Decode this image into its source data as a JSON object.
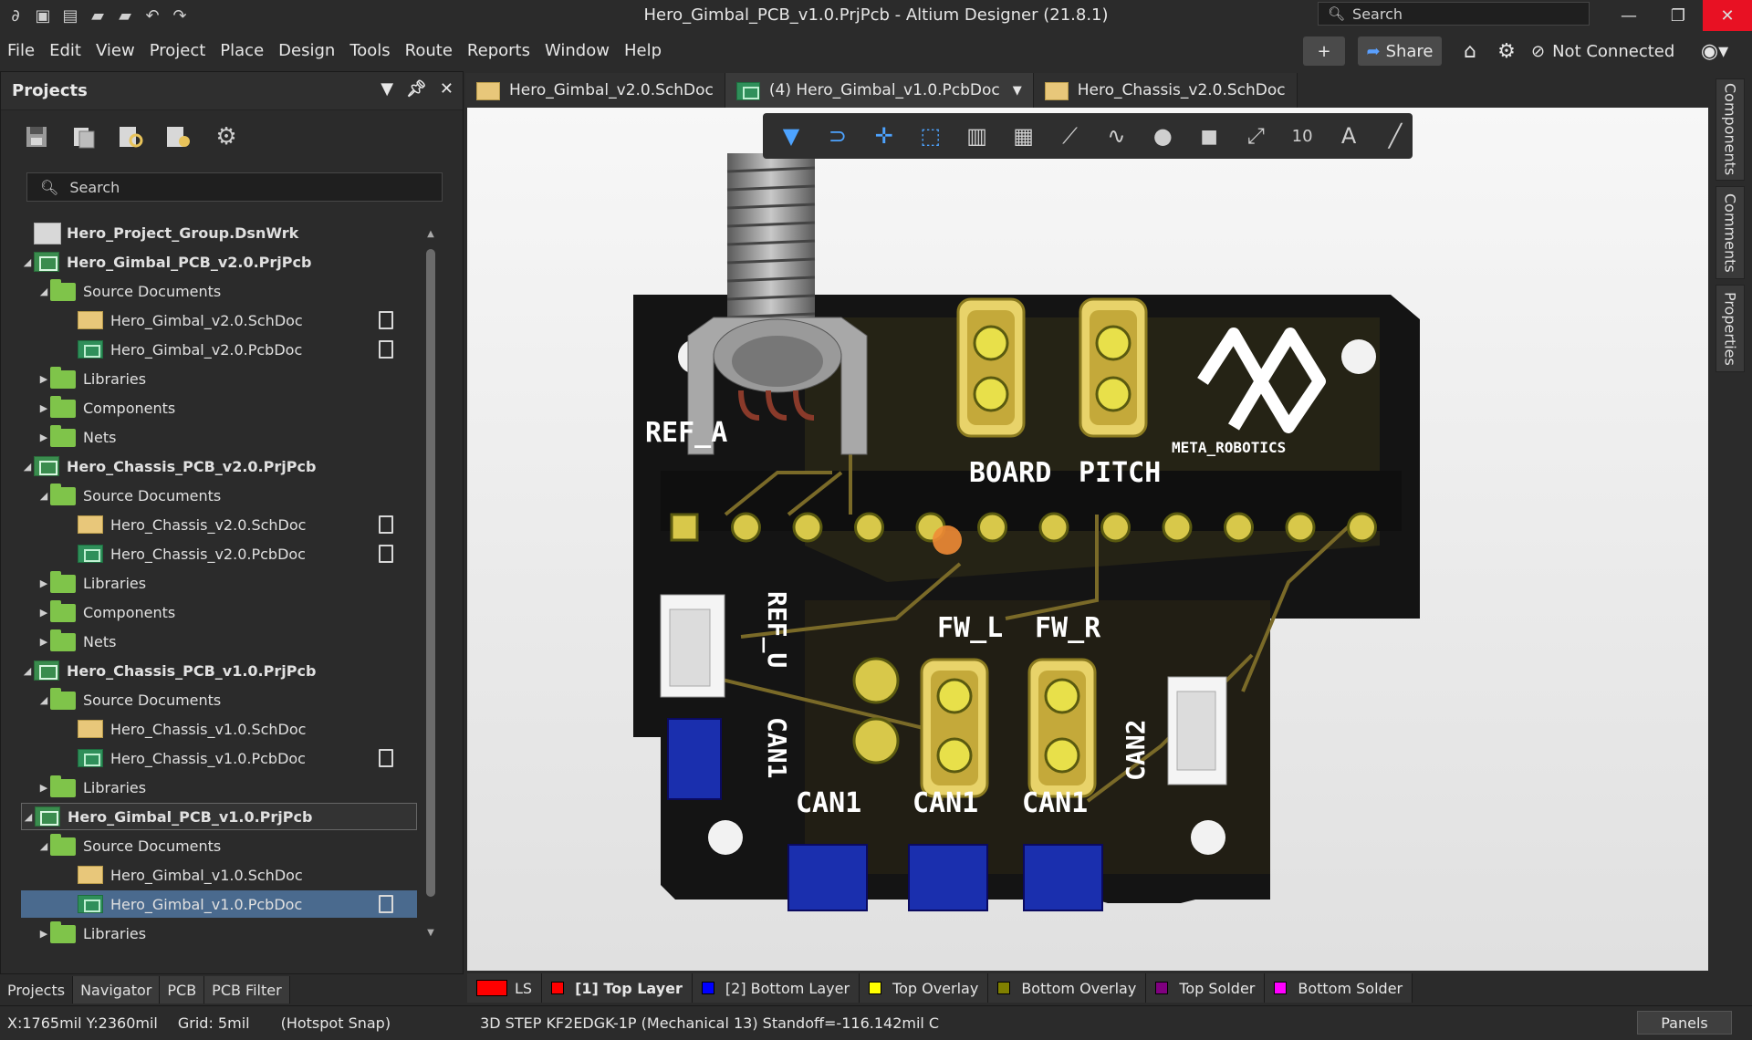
{
  "titlebar": {
    "title": "Hero_Gimbal_PCB_v1.0.PrjPcb - Altium Designer (21.8.1)",
    "search_placeholder": "Search"
  },
  "menu": [
    "File",
    "Edit",
    "View",
    "Project",
    "Place",
    "Design",
    "Tools",
    "Route",
    "Reports",
    "Window",
    "Help"
  ],
  "header_right": {
    "share_label": "Share",
    "connection_status": "Not Connected"
  },
  "projects_panel": {
    "title": "Projects",
    "search_placeholder": "Search",
    "tree": [
      {
        "label": "Hero_Project_Group.DsnWrk",
        "type": "group",
        "level": 0,
        "bold": true
      },
      {
        "label": "Hero_Gimbal_PCB_v2.0.PrjPcb",
        "type": "project",
        "level": 0,
        "bold": true
      },
      {
        "label": "Source Documents",
        "type": "folder",
        "level": 1
      },
      {
        "label": "Hero_Gimbal_v2.0.SchDoc",
        "type": "sch",
        "level": 2,
        "doc": true
      },
      {
        "label": "Hero_Gimbal_v2.0.PcbDoc",
        "type": "pcb",
        "level": 2,
        "doc": true
      },
      {
        "label": "Libraries",
        "type": "folder",
        "level": 1,
        "collapsed": true
      },
      {
        "label": "Components",
        "type": "folder",
        "level": 1,
        "collapsed": true
      },
      {
        "label": "Nets",
        "type": "folder",
        "level": 1,
        "collapsed": true
      },
      {
        "label": "Hero_Chassis_PCB_v2.0.PrjPcb",
        "type": "project",
        "level": 0,
        "bold": true
      },
      {
        "label": "Source Documents",
        "type": "folder",
        "level": 1
      },
      {
        "label": "Hero_Chassis_v2.0.SchDoc",
        "type": "sch",
        "level": 2,
        "doc": true
      },
      {
        "label": "Hero_Chassis_v2.0.PcbDoc",
        "type": "pcb",
        "level": 2,
        "doc": true
      },
      {
        "label": "Libraries",
        "type": "folder",
        "level": 1,
        "collapsed": true
      },
      {
        "label": "Components",
        "type": "folder",
        "level": 1,
        "collapsed": true
      },
      {
        "label": "Nets",
        "type": "folder",
        "level": 1,
        "collapsed": true
      },
      {
        "label": "Hero_Chassis_PCB_v1.0.PrjPcb",
        "type": "project",
        "level": 0,
        "bold": true
      },
      {
        "label": "Source Documents",
        "type": "folder",
        "level": 1
      },
      {
        "label": "Hero_Chassis_v1.0.SchDoc",
        "type": "sch",
        "level": 2
      },
      {
        "label": "Hero_Chassis_v1.0.PcbDoc",
        "type": "pcb",
        "level": 2,
        "doc": true
      },
      {
        "label": "Libraries",
        "type": "folder",
        "level": 1,
        "collapsed": true
      },
      {
        "label": "Hero_Gimbal_PCB_v1.0.PrjPcb",
        "type": "project",
        "level": 0,
        "bold": true,
        "highlight": true
      },
      {
        "label": "Source Documents",
        "type": "folder",
        "level": 1
      },
      {
        "label": "Hero_Gimbal_v1.0.SchDoc",
        "type": "sch",
        "level": 2
      },
      {
        "label": "Hero_Gimbal_v1.0.PcbDoc",
        "type": "pcb",
        "level": 2,
        "doc": true,
        "selected": true
      },
      {
        "label": "Libraries",
        "type": "folder",
        "level": 1,
        "collapsed": true
      }
    ],
    "tabs": [
      "Projects",
      "Navigator",
      "PCB",
      "PCB Filter"
    ]
  },
  "doc_tabs": [
    {
      "label": "Hero_Gimbal_v2.0.SchDoc",
      "type": "sch"
    },
    {
      "label": "(4) Hero_Gimbal_v1.0.PcbDoc",
      "type": "pcb",
      "active": true
    },
    {
      "label": "Hero_Chassis_v2.0.SchDoc",
      "type": "sch"
    }
  ],
  "right_panels": [
    "Components",
    "Comments",
    "Properties"
  ],
  "pcb": {
    "labels": {
      "ref_a": "REF_A",
      "board": "BOARD",
      "pitch": "PITCH",
      "logo": "META_ROBOTICS",
      "ref_u": "REF_U",
      "fw_l": "FW_L",
      "fw_r": "FW_R",
      "can1_v": "CAN1",
      "can2_v": "CAN2",
      "can1_a": "CAN1",
      "can1_b": "CAN1",
      "can1_c": "CAN1"
    }
  },
  "layers": [
    {
      "label": "LS",
      "color": "#ff0000",
      "kind": "ls"
    },
    {
      "label": "[1] Top Layer",
      "color": "#ff0000",
      "bold": true
    },
    {
      "label": "[2] Bottom Layer",
      "color": "#0000ff"
    },
    {
      "label": "Top Overlay",
      "color": "#ffff00"
    },
    {
      "label": "Bottom Overlay",
      "color": "#808000"
    },
    {
      "label": "Top Solder",
      "color": "#800080"
    },
    {
      "label": "Bottom Solder",
      "color": "#ff00ff"
    }
  ],
  "status": {
    "coords": "X:1765mil Y:2360mil",
    "grid": "Grid: 5mil",
    "snap": "(Hotspot Snap)",
    "object": "3D STEP KF2EDGK-1P (Mechanical 13)  Standoff=-116.142mil  C",
    "panels": "Panels"
  }
}
